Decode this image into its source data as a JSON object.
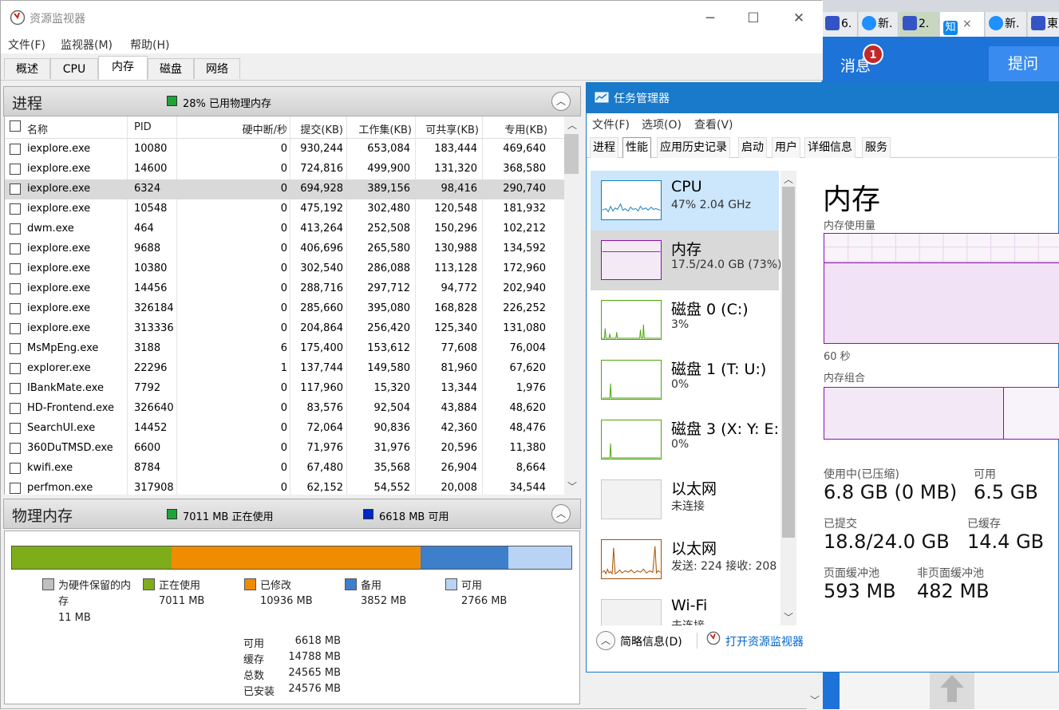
{
  "browser": {
    "tabs": [
      {
        "label": "6.",
        "icon": "paw-icon"
      },
      {
        "label": "新.",
        "icon": "ie-icon"
      },
      {
        "label": "2.",
        "icon": "paw-icon"
      },
      {
        "label": "知",
        "icon": "zhihu-icon",
        "close": "×"
      },
      {
        "label": "新.",
        "icon": "ie-icon"
      },
      {
        "label": "東",
        "icon": "paw-icon"
      }
    ],
    "message_label": "消息",
    "message_badge": "1",
    "ask_button": "提问"
  },
  "resmon": {
    "title": "资源监视器",
    "menu": [
      "文件(F)",
      "监视器(M)",
      "帮助(H)"
    ],
    "tabs": [
      "概述",
      "CPU",
      "内存",
      "磁盘",
      "网络"
    ],
    "active_tab": "内存",
    "processes_section": {
      "title": "进程",
      "status": "28% 已用物理内存",
      "columns": [
        "名称",
        "PID",
        "硬中断/秒",
        "提交(KB)",
        "工作集(KB)",
        "可共享(KB)",
        "专用(KB)"
      ],
      "rows": [
        [
          "iexplore.exe",
          "10080",
          "0",
          "930,244",
          "653,084",
          "183,444",
          "469,640"
        ],
        [
          "iexplore.exe",
          "14600",
          "0",
          "724,816",
          "499,900",
          "131,320",
          "368,580"
        ],
        [
          "iexplore.exe",
          "6324",
          "0",
          "694,928",
          "389,156",
          "98,416",
          "290,740"
        ],
        [
          "iexplore.exe",
          "10548",
          "0",
          "475,192",
          "302,480",
          "120,548",
          "181,932"
        ],
        [
          "dwm.exe",
          "464",
          "0",
          "413,264",
          "252,508",
          "150,296",
          "102,212"
        ],
        [
          "iexplore.exe",
          "9688",
          "0",
          "406,696",
          "265,580",
          "130,988",
          "134,592"
        ],
        [
          "iexplore.exe",
          "10380",
          "0",
          "302,540",
          "286,088",
          "113,128",
          "172,960"
        ],
        [
          "iexplore.exe",
          "14456",
          "0",
          "288,716",
          "297,712",
          "94,772",
          "202,940"
        ],
        [
          "iexplore.exe",
          "326184",
          "0",
          "285,660",
          "395,080",
          "168,828",
          "226,252"
        ],
        [
          "iexplore.exe",
          "313336",
          "0",
          "204,864",
          "256,420",
          "125,340",
          "131,080"
        ],
        [
          "MsMpEng.exe",
          "3188",
          "6",
          "175,400",
          "153,612",
          "77,608",
          "76,004"
        ],
        [
          "explorer.exe",
          "22296",
          "1",
          "137,744",
          "149,580",
          "81,960",
          "67,620"
        ],
        [
          "IBankMate.exe",
          "7792",
          "0",
          "117,960",
          "15,320",
          "13,344",
          "1,976"
        ],
        [
          "HD-Frontend.exe",
          "326640",
          "0",
          "83,576",
          "92,504",
          "43,884",
          "48,620"
        ],
        [
          "SearchUI.exe",
          "14452",
          "0",
          "72,064",
          "90,836",
          "42,360",
          "48,476"
        ],
        [
          "360DuTMSD.exe",
          "6600",
          "0",
          "71,976",
          "31,976",
          "20,596",
          "11,380"
        ],
        [
          "kwifi.exe",
          "8784",
          "0",
          "67,480",
          "35,568",
          "26,904",
          "8,664"
        ],
        [
          "perfmon.exe",
          "317908",
          "0",
          "62,152",
          "54,552",
          "20,008",
          "34,544"
        ]
      ]
    },
    "physical_section": {
      "title": "物理内存",
      "in_use_status": "7011 MB 正在使用",
      "available_status": "6618 MB 可用",
      "legend": [
        {
          "name": "为硬件保留的内存",
          "value": "11 MB",
          "color": "#c0c0c0",
          "mb": 11
        },
        {
          "name": "正在使用",
          "value": "7011 MB",
          "color": "#7ead1a",
          "mb": 7011
        },
        {
          "name": "已修改",
          "value": "10936 MB",
          "color": "#f08c00",
          "mb": 10936
        },
        {
          "name": "备用",
          "value": "3852 MB",
          "color": "#3d7fcb",
          "mb": 3852
        },
        {
          "name": "可用",
          "value": "2766 MB",
          "color": "#b8d3f3",
          "mb": 2766
        }
      ],
      "summary": [
        {
          "label": "可用",
          "value": "6618 MB"
        },
        {
          "label": "缓存",
          "value": "14788 MB"
        },
        {
          "label": "总数",
          "value": "24565 MB"
        },
        {
          "label": "已安装",
          "value": "24576 MB"
        }
      ]
    }
  },
  "taskmgr": {
    "title": "任务管理器",
    "menu": [
      "文件(F)",
      "选项(O)",
      "查看(V)"
    ],
    "tabs": [
      "进程",
      "性能",
      "应用历史记录",
      "启动",
      "用户",
      "详细信息",
      "服务"
    ],
    "active_tab": "性能",
    "side": [
      {
        "name": "CPU",
        "sub": "47% 2.04 GHz",
        "color": "#117dbb"
      },
      {
        "name": "内存",
        "sub": "17.5/24.0 GB (73%)",
        "color": "#8b12ae"
      },
      {
        "name": "磁盘 0 (C:)",
        "sub": "3%",
        "color": "#4da60c"
      },
      {
        "name": "磁盘 1 (T: U:)",
        "sub": "0%",
        "color": "#4da60c"
      },
      {
        "name": "磁盘 3 (X: Y: E:",
        "sub": "0%",
        "color": "#4da60c"
      },
      {
        "name": "以太网",
        "sub": "未连接",
        "color": "#a7a7a7"
      },
      {
        "name": "以太网",
        "sub": "发送: 224 接收: 208",
        "color": "#a74f01"
      },
      {
        "name": "Wi-Fi",
        "sub": "未连接",
        "color": "#a7a7a7"
      }
    ],
    "detail": {
      "title": "内存",
      "usage_label": "内存使用量",
      "time_label": "60 秒",
      "composition_label": "内存组合",
      "stats": [
        {
          "label": "使用中(已压缩)",
          "value": "6.8 GB (0 MB)"
        },
        {
          "label": "可用",
          "value": "6.5 GB"
        },
        {
          "label": "已提交",
          "value": "18.8/24.0 GB"
        },
        {
          "label": "已缓存",
          "value": "14.4 GB"
        },
        {
          "label": "页面缓冲池",
          "value": "593 MB"
        },
        {
          "label": "非页面缓冲池",
          "value": "482 MB"
        }
      ]
    },
    "fewer_details": "简略信息(D)",
    "open_resmon": "打开资源监视器"
  }
}
